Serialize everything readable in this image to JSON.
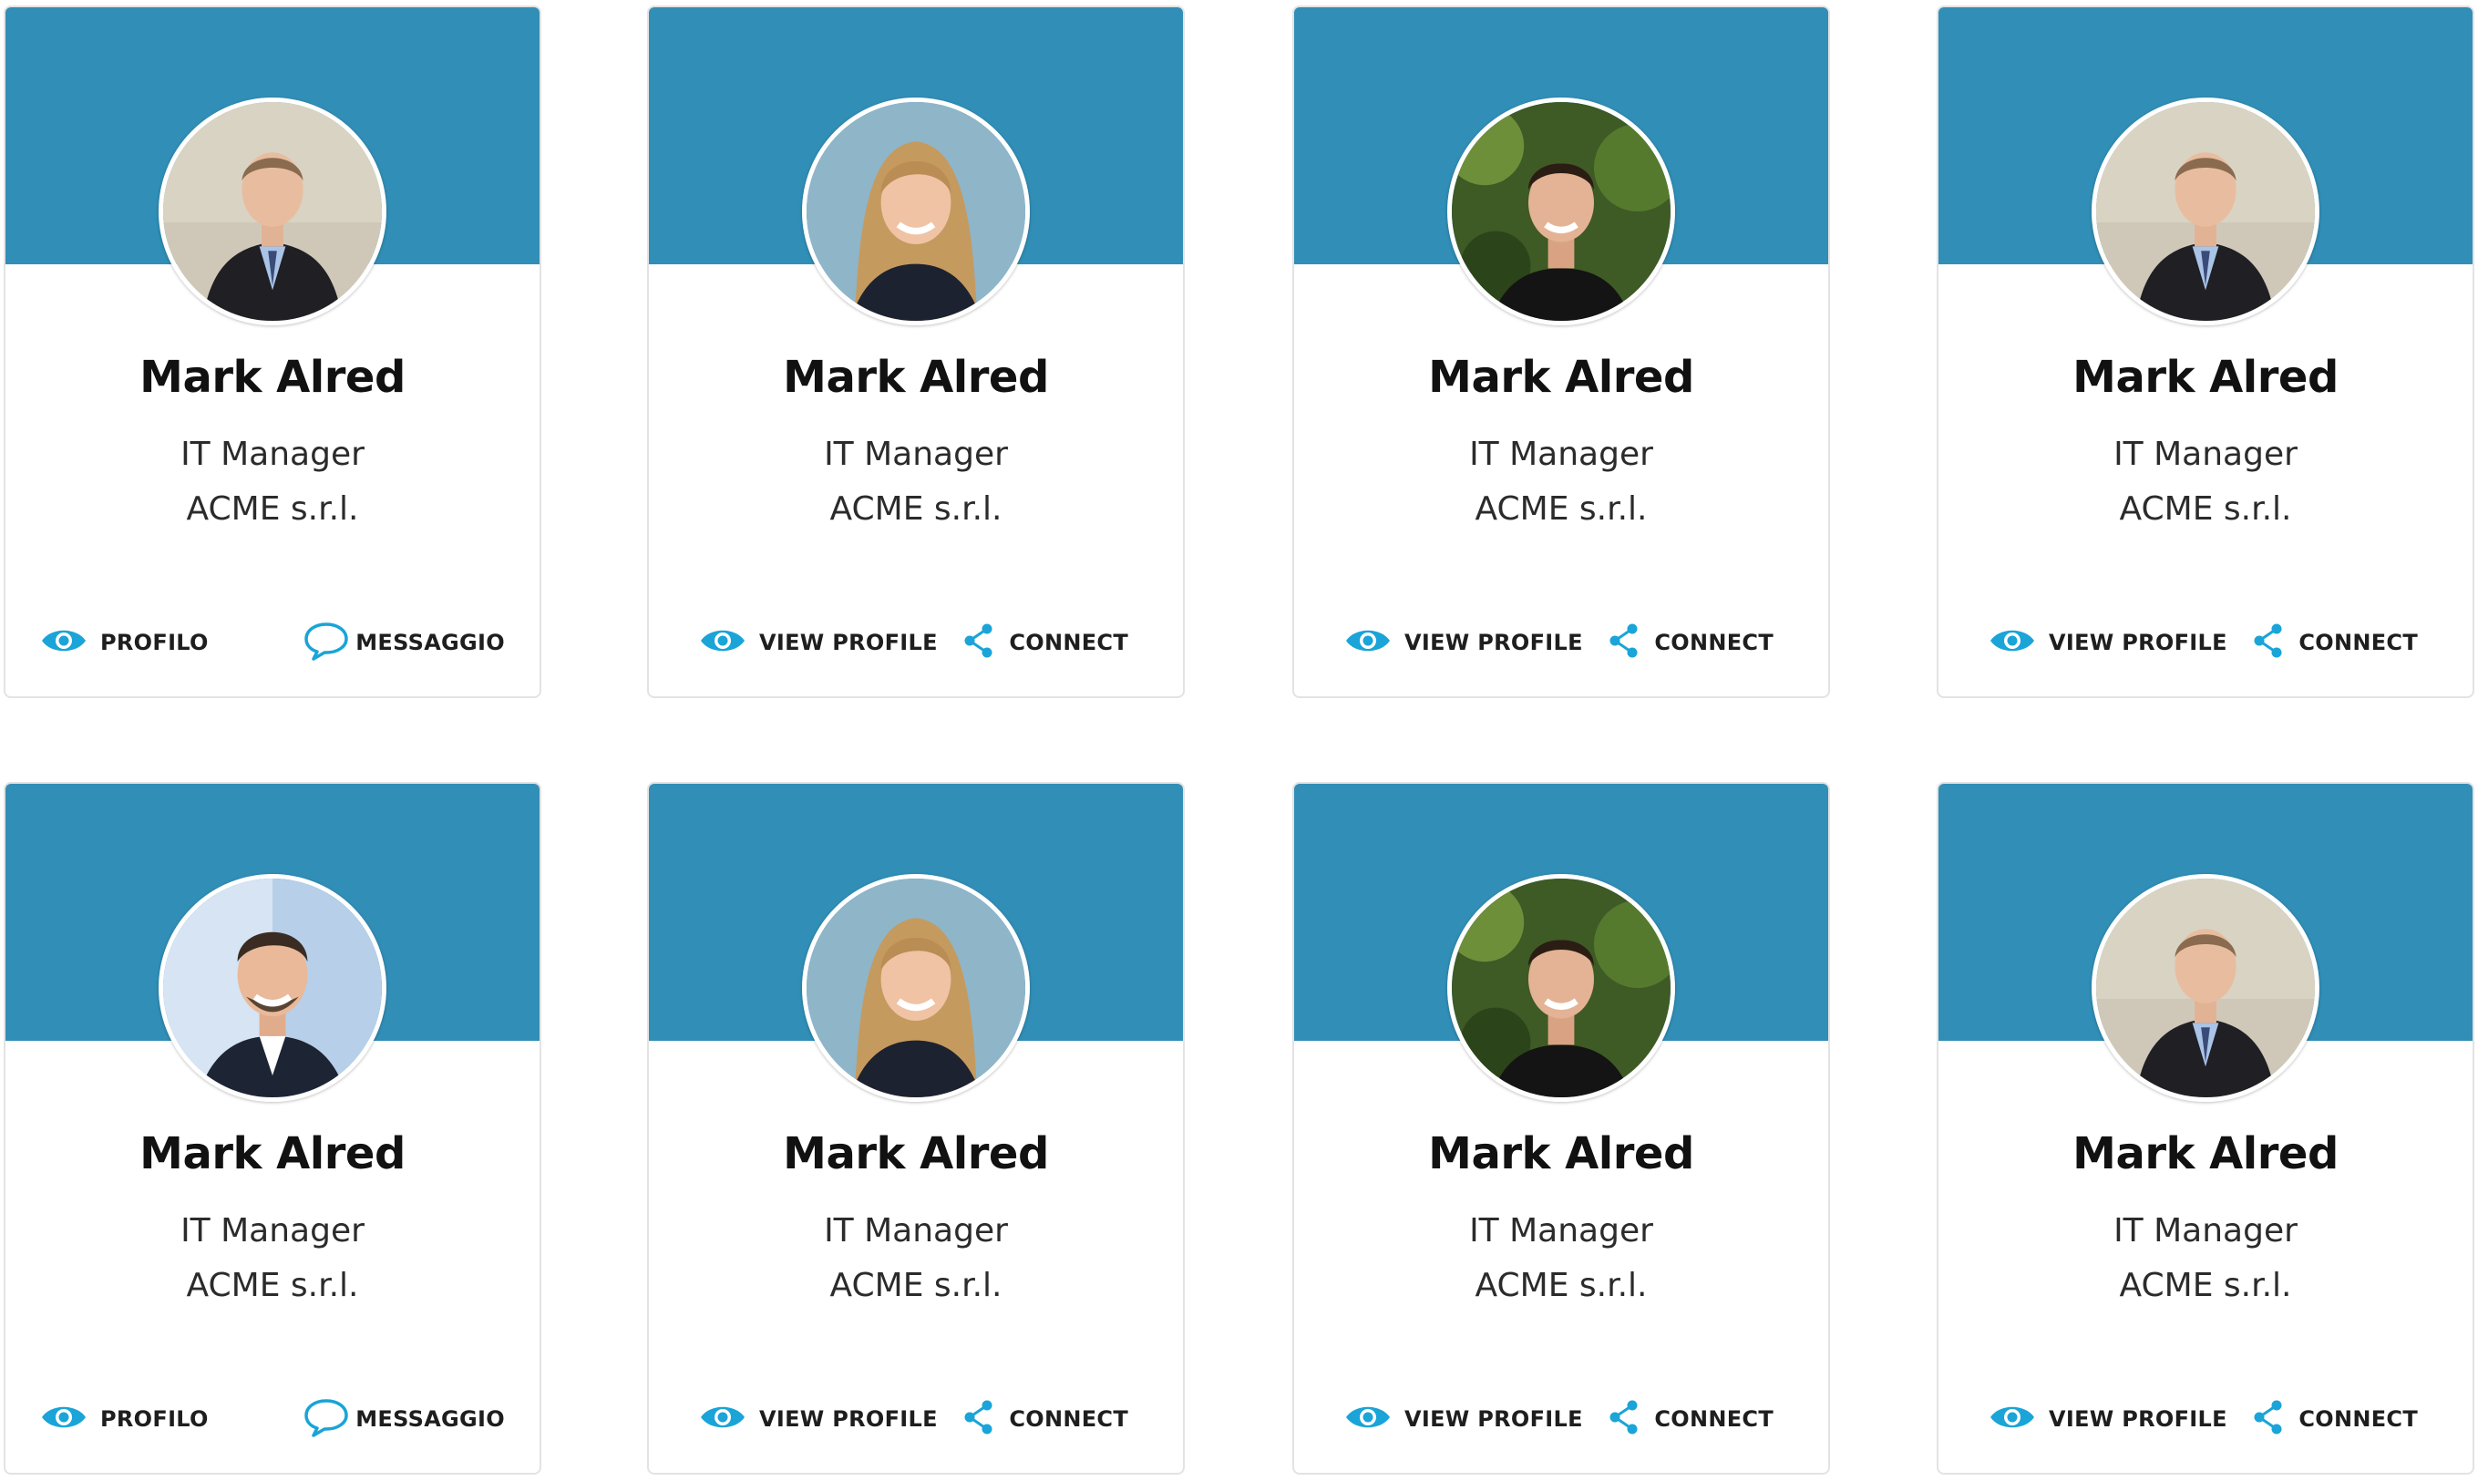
{
  "accent": "#318eb6",
  "icon_color": "#1aa4d8",
  "cards": [
    {
      "name": "Mark Alred",
      "role": "IT Manager",
      "company": "ACME s.r.l.",
      "avatar": "man-suit-avatar",
      "primary_action": "PROFILO",
      "secondary_action": "MESSAGGIO",
      "primary_icon": "eye-icon",
      "secondary_icon": "chat-bubble-icon"
    },
    {
      "name": "Mark Alred",
      "role": "IT Manager",
      "company": "ACME s.r.l.",
      "avatar": "woman-blonde-avatar",
      "primary_action": "VIEW PROFILE",
      "secondary_action": "CONNECT",
      "primary_icon": "eye-icon",
      "secondary_icon": "share-icon"
    },
    {
      "name": "Mark Alred",
      "role": "IT Manager",
      "company": "ACME s.r.l.",
      "avatar": "young-man-avatar",
      "primary_action": "VIEW PROFILE",
      "secondary_action": "CONNECT",
      "primary_icon": "eye-icon",
      "secondary_icon": "share-icon"
    },
    {
      "name": "Mark Alred",
      "role": "IT Manager",
      "company": "ACME s.r.l.",
      "avatar": "man-suit-avatar",
      "primary_action": "VIEW PROFILE",
      "secondary_action": "CONNECT",
      "primary_icon": "eye-icon",
      "secondary_icon": "share-icon"
    },
    {
      "name": "Mark Alred",
      "role": "IT Manager",
      "company": "ACME s.r.l.",
      "avatar": "man-smiling-avatar",
      "primary_action": "PROFILO",
      "secondary_action": "MESSAGGIO",
      "primary_icon": "eye-icon",
      "secondary_icon": "chat-bubble-icon"
    },
    {
      "name": "Mark Alred",
      "role": "IT Manager",
      "company": "ACME s.r.l.",
      "avatar": "woman-blonde-avatar",
      "primary_action": "VIEW PROFILE",
      "secondary_action": "CONNECT",
      "primary_icon": "eye-icon",
      "secondary_icon": "share-icon"
    },
    {
      "name": "Mark Alred",
      "role": "IT Manager",
      "company": "ACME s.r.l.",
      "avatar": "young-man-avatar",
      "primary_action": "VIEW PROFILE",
      "secondary_action": "CONNECT",
      "primary_icon": "eye-icon",
      "secondary_icon": "share-icon"
    },
    {
      "name": "Mark Alred",
      "role": "IT Manager",
      "company": "ACME s.r.l.",
      "avatar": "man-suit-avatar",
      "primary_action": "VIEW PROFILE",
      "secondary_action": "CONNECT",
      "primary_icon": "eye-icon",
      "secondary_icon": "share-icon"
    }
  ]
}
